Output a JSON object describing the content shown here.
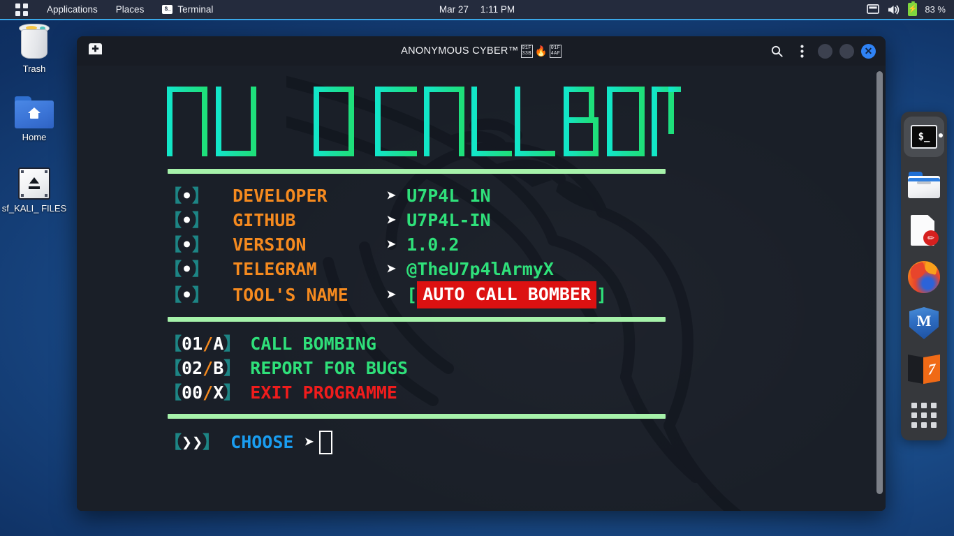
{
  "top_panel": {
    "activities_icon": "grid-icon",
    "applications_label": "Applications",
    "places_label": "Places",
    "terminal_label": "Terminal",
    "terminal_icon_text": "$_",
    "date": "Mar 27",
    "time": "1:11 PM",
    "display_icon": "display-icon",
    "volume_icon": "volume-icon",
    "battery_icon": "battery-charging-icon",
    "battery_label": "83 %"
  },
  "desktop_icons": [
    {
      "name": "Trash",
      "icon": "trash-icon"
    },
    {
      "name": "Home",
      "icon": "home-folder-icon"
    },
    {
      "name": "sf_KALI_\nFILES",
      "icon": "drive-eject-icon"
    }
  ],
  "window": {
    "tab_icon": "new-tab-icon",
    "title": "ANONYMOUS CYBER™",
    "title_tofu": [
      "01F\n33B",
      "01F\n4AF"
    ],
    "fire_glyph": "🔥",
    "search_icon": "search-icon",
    "menu_icon": "kebab-menu-icon",
    "minimize_icon": "minimize-button",
    "maximize_icon": "maximize-button",
    "close_icon": "close-button",
    "close_glyph": "✕"
  },
  "banner": {
    "text": "AUTO CALL BOMBER",
    "gradient_from": "#12e6c8",
    "gradient_to": "#1ee07a"
  },
  "info_rows": [
    {
      "bracket_open": "【",
      "bullet": "•",
      "bracket_close": "】",
      "label": "DEVELOPER",
      "arrow": "➤",
      "value": "U7P4L 1N",
      "style": "plain"
    },
    {
      "bracket_open": "【",
      "bullet": "•",
      "bracket_close": "】",
      "label": "GITHUB",
      "arrow": "➤",
      "value": "U7P4L-IN",
      "style": "plain"
    },
    {
      "bracket_open": "【",
      "bullet": "•",
      "bracket_close": "】",
      "label": "VERSION",
      "arrow": "➤",
      "value": "1.0.2",
      "style": "plain"
    },
    {
      "bracket_open": "【",
      "bullet": "•",
      "bracket_close": "】",
      "label": "TELEGRAM",
      "arrow": "➤",
      "value": "@TheU7p4lArmyX",
      "style": "plain"
    },
    {
      "bracket_open": "【",
      "bullet": "•",
      "bracket_close": "】",
      "label": "TOOL'S NAME",
      "arrow": "➤",
      "value": "AUTO CALL BOMBER",
      "style": "highlight",
      "wrap_open": "[",
      "wrap_close": "]"
    }
  ],
  "menu_rows": [
    {
      "bracket_open": "【",
      "num": "01",
      "slash": "/",
      "key": "A",
      "bracket_close": "】",
      "label": "CALL BOMBING",
      "color": "green"
    },
    {
      "bracket_open": "【",
      "num": "02",
      "slash": "/",
      "key": "B",
      "bracket_close": "】",
      "label": "REPORT FOR BUGS",
      "color": "green"
    },
    {
      "bracket_open": "【",
      "num": "00",
      "slash": "/",
      "key": "X",
      "bracket_close": "】",
      "label": "EXIT PROGRAMME",
      "color": "red"
    }
  ],
  "prompt": {
    "bracket_open": "【",
    "chevrons": "❯❯",
    "bracket_close": "】",
    "label": "CHOOSE",
    "arrow": "➤",
    "value": ""
  },
  "dock": [
    {
      "name": "Terminal",
      "icon": "terminal-icon",
      "glyph": "$_",
      "active": true
    },
    {
      "name": "Files",
      "icon": "file-manager-icon",
      "glyph": "",
      "active": false
    },
    {
      "name": "Text Editor",
      "icon": "text-editor-icon",
      "glyph": "✏",
      "active": false
    },
    {
      "name": "Firefox",
      "icon": "firefox-icon",
      "glyph": "",
      "active": false
    },
    {
      "name": "Metasploit",
      "icon": "metasploit-icon",
      "glyph": "M",
      "active": false
    },
    {
      "name": "Burp Suite",
      "icon": "burpsuite-icon",
      "glyph": "7",
      "active": false
    },
    {
      "name": "Show Apps",
      "icon": "app-grid-icon",
      "glyph": "",
      "active": false
    }
  ],
  "colors": {
    "panel_bg": "#242b3d",
    "panel_accent": "#3aa7e8",
    "terminal_bg": "#1a1f28",
    "titlebar_bg": "#181c24",
    "bracket_teal": "#1d8585",
    "label_orange": "#f58a1f",
    "value_green": "#2fe07a",
    "rule_green": "#a6f2aa",
    "highlight_red": "#dc1111",
    "exit_red": "#f01c1c",
    "choose_blue": "#1a9df0",
    "close_blue": "#2f83f6"
  }
}
